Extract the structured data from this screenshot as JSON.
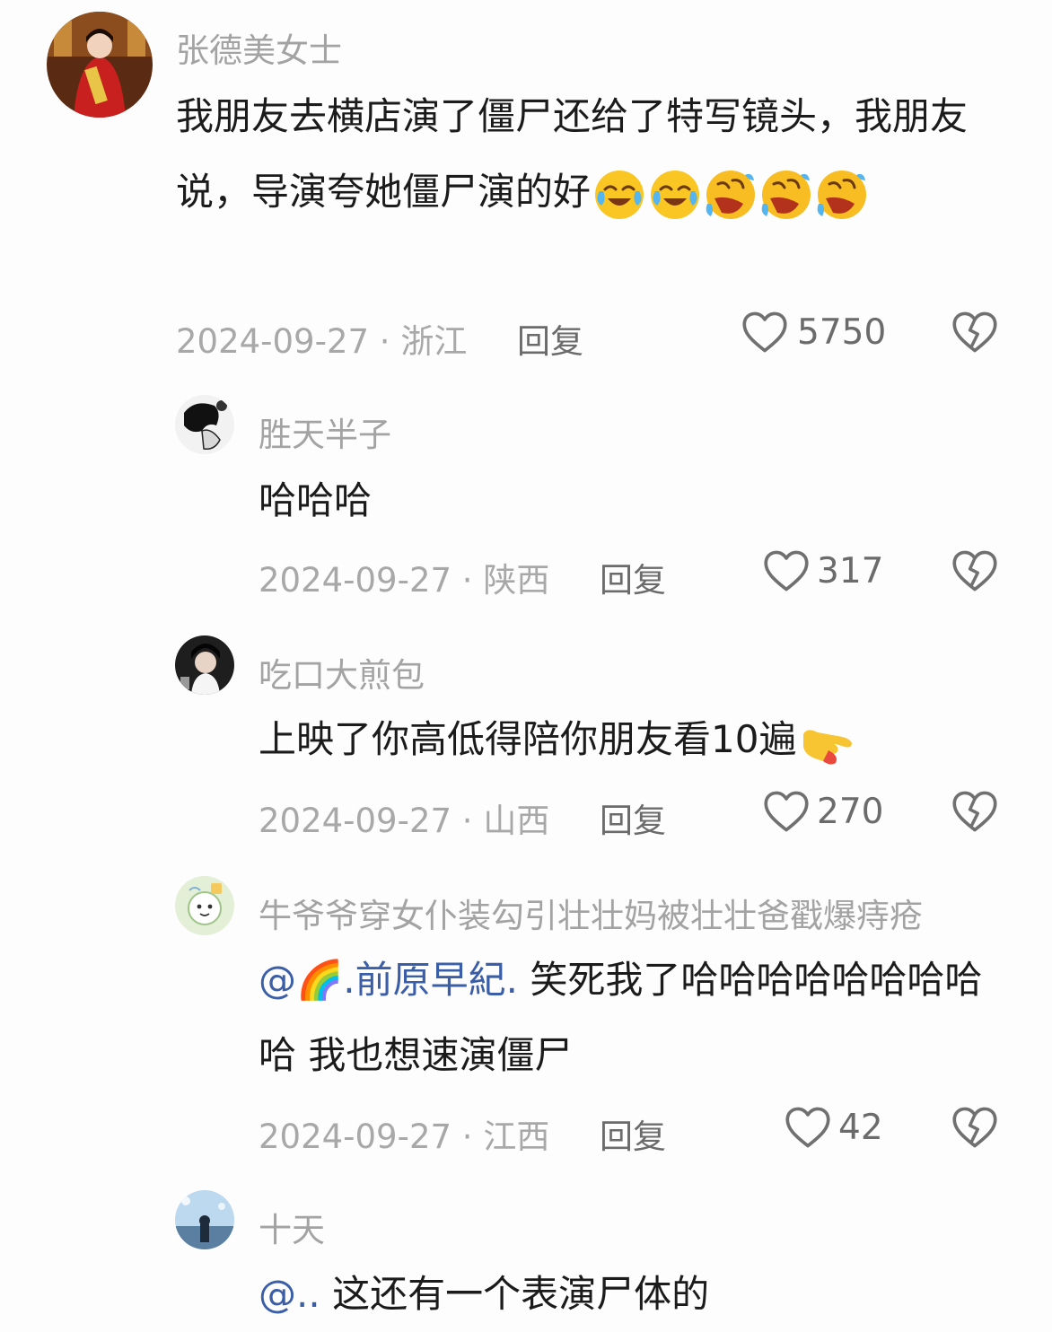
{
  "comments": [
    {
      "username": "张德美女士",
      "text": "我朋友去横店演了僵尸还给了特写镜头，我朋友说，导演夸她僵尸演的好",
      "emojis": [
        "crying-laughing-emoji",
        "crying-laughing-emoji",
        "rolling-laughing-emoji",
        "rolling-laughing-emoji",
        "rolling-laughing-emoji"
      ],
      "date": "2024-09-27",
      "location": "浙江",
      "reply_label": "回复",
      "likes": "5750"
    },
    {
      "username": "胜天半子",
      "text": "哈哈哈",
      "date": "2024-09-27",
      "location": "陕西",
      "reply_label": "回复",
      "likes": "317"
    },
    {
      "username": "吃口大煎包",
      "text": "上映了你高低得陪你朋友看10遍",
      "emojis": [
        "pointing-hand-emoji"
      ],
      "date": "2024-09-27",
      "location": "山西",
      "reply_label": "回复",
      "likes": "270"
    },
    {
      "username": "牛爷爷穿女仆装勾引壮壮妈被壮壮爸戳爆痔疮",
      "mention": "@🌈.前原早紀.",
      "text": "笑死我了哈哈哈哈哈哈哈哈哈 我也想速演僵尸",
      "date": "2024-09-27",
      "location": "江西",
      "reply_label": "回复",
      "likes": "42"
    },
    {
      "username": "十天",
      "mention": "@..",
      "text": "这还有一个表演尸体的"
    }
  ],
  "separator": " · ",
  "colors": {
    "mention": "#3b5ea8",
    "meta": "#a8a8a8",
    "username": "#a3a3a3",
    "text": "#1b1b1b"
  },
  "icons": {
    "like": "heart-outline-icon",
    "dislike": "broken-heart-icon"
  }
}
